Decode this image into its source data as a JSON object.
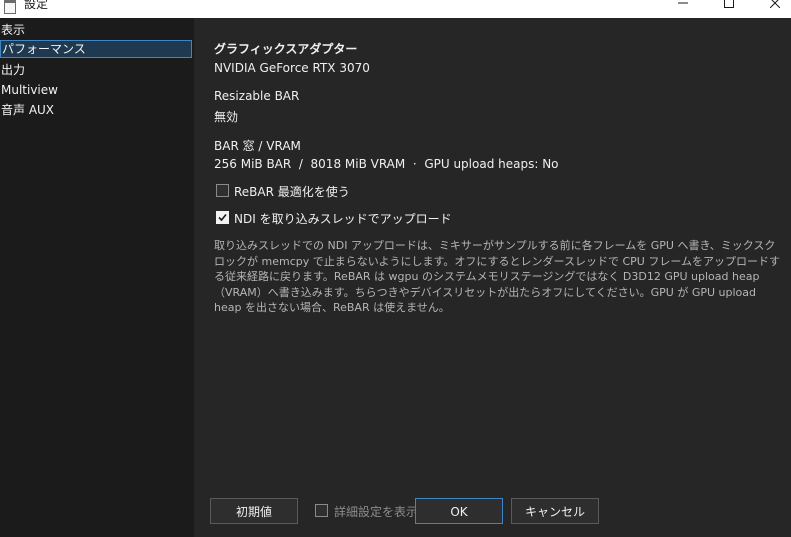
{
  "window": {
    "title": "設定",
    "controls": {
      "minimize": "minimize-icon",
      "maximize": "maximize-icon",
      "close": "close-icon"
    }
  },
  "sidebar": {
    "items": [
      {
        "label": "表示",
        "selected": false
      },
      {
        "label": "パフォーマンス",
        "selected": true
      },
      {
        "label": "出力",
        "selected": false
      },
      {
        "label": "Multiview",
        "selected": false
      },
      {
        "label": "音声 AUX",
        "selected": false
      }
    ]
  },
  "performance": {
    "adapter_heading": "グラフィックスアダプター",
    "adapter_value": "NVIDIA GeForce RTX 3070",
    "rebar_heading": "Resizable BAR",
    "rebar_value": "無効",
    "bar_heading": "BAR 窓 / VRAM",
    "bar_value": "256 MiB BAR  /  8018 MiB VRAM  ·  GPU upload heaps: No",
    "rebar_opt_label": "ReBAR 最適化を使う",
    "rebar_opt_checked": false,
    "ndi_label": "NDI を取り込みスレッドでアップロード",
    "ndi_checked": true,
    "description": "取り込みスレッドでの NDI アップロードは、ミキサーがサンプルする前に各フレームを GPU へ書き、ミックスクロックが memcpy で止まらないようにします。オフにするとレンダースレッドで CPU フレームをアップロードする従来経路に戻ります。ReBAR は wgpu のシステムメモリステージングではなく D3D12 GPU upload heap（VRAM）へ書き込みます。ちらつきやデバイスリセットが出たらオフにしてください。GPU が GPU upload heap を出さない場合、ReBAR は使えません。"
  },
  "footer": {
    "reset_label": "初期値",
    "advanced_label": "詳細設定を表示",
    "advanced_checked": false,
    "ok_label": "OK",
    "cancel_label": "キャンセル"
  },
  "colors": {
    "accent": "#3f86c4",
    "selected_bg": "#1f3a50",
    "content_bg": "#262626",
    "sidebar_bg": "#1b1b1b"
  }
}
